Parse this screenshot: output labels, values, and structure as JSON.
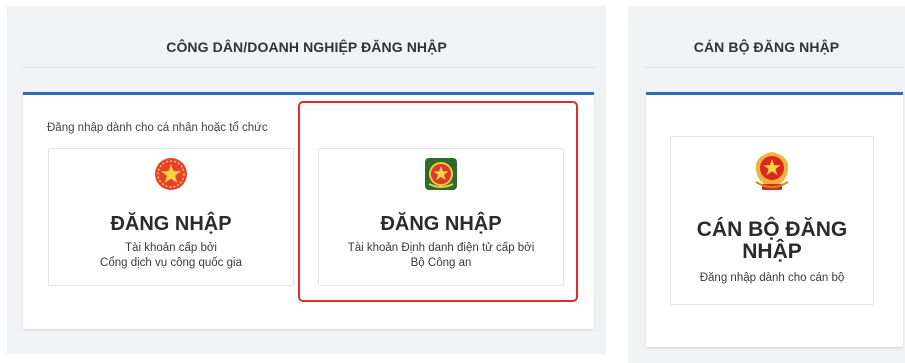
{
  "citizen_panel": {
    "title": "CÔNG DÂN/DOANH NGHIỆP ĐĂNG NHẬP",
    "subtitle": "Đăng nhập dành cho cá nhân hoặc tổ chức",
    "cards": [
      {
        "title": "ĐĂNG NHẬP",
        "desc_line1": "Tài khoản cấp bởi",
        "desc_line2": "Cổng dịch vụ công quốc gia",
        "icon": "national-emblem-star-icon"
      },
      {
        "title": "ĐĂNG NHẬP",
        "desc_line1": "Tài khoản Định danh điện tử cấp bởi",
        "desc_line2": "Bộ Công an",
        "icon": "police-badge-icon"
      }
    ]
  },
  "officer_panel": {
    "title": "CÁN BỘ ĐĂNG NHẬP",
    "card": {
      "title_line1": "CÁN BỘ ĐĂNG",
      "title_line2": "NHẬP",
      "desc": "Đăng nhập dành cho cán bộ",
      "icon": "vietnam-emblem-icon"
    }
  },
  "colors": {
    "accent_border": "#2a6fb3",
    "highlight": "#e02b2b",
    "panel_bg": "#f1f2f4"
  }
}
